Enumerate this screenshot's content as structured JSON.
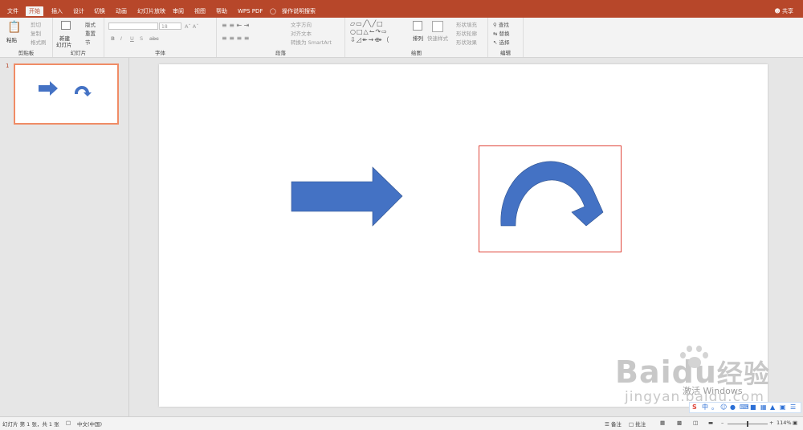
{
  "tabs": [
    "文件",
    "开始",
    "插入",
    "设计",
    "切换",
    "动画",
    "幻灯片放映",
    "审阅",
    "视图",
    "帮助",
    "WPS PDF",
    "操作说明搜索"
  ],
  "active_tab": "开始",
  "share_label": "共享",
  "ribbon": {
    "clipboard": {
      "paste": "粘贴",
      "cut": "剪切",
      "copy": "复制",
      "format_painter": "格式刷",
      "label": "剪贴板"
    },
    "slides": {
      "new_slide_line1": "新建",
      "new_slide_line2": "幻灯片",
      "layout": "版式",
      "reset": "重置",
      "section": "节",
      "label": "幻灯片"
    },
    "font": {
      "font_name": "",
      "font_size": "18",
      "label": "字体",
      "bold": "B",
      "italic": "I",
      "underline": "U",
      "shadow": "S",
      "strike": "abc"
    },
    "paragraph": {
      "text_direction": "文字方向",
      "align_text": "对齐文本",
      "smartart": "转换为 SmartArt",
      "label": "段落"
    },
    "drawing": {
      "arrange": "排列",
      "quick_styles": "快速样式",
      "shape_fill": "形状填充",
      "shape_outline": "形状轮廓",
      "shape_effects": "形状效果",
      "label": "绘图"
    },
    "editing": {
      "find": "查找",
      "replace": "替换",
      "select": "选择",
      "label": "编辑"
    }
  },
  "thumbnail_number": "1",
  "status": {
    "slide_info": "幻灯片 第 1 张，共 1 张",
    "language": "中文(中国)",
    "notes": "备注",
    "comments": "批注",
    "zoom": "114%"
  },
  "overlay": {
    "activate_windows": "激活 Windows",
    "baidu_logo": "Bai",
    "baidu_du": "du",
    "baidu_jingyan": "经验",
    "baidu_url": "jingyan.baidu.com"
  },
  "colors": {
    "accent": "#b7472a",
    "shape_blue": "#4472c4",
    "shape_stroke": "#2f528f",
    "selection_red": "#e0463b"
  },
  "icons": [
    "mic-icon",
    "paste-icon",
    "find-icon",
    "share-person-icon"
  ]
}
